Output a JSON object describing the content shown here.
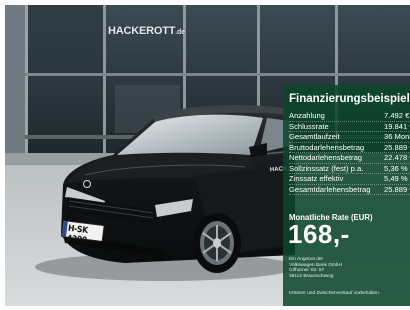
{
  "scene": {
    "dealer_sign": "HACKEROTT",
    "dealer_sign_suffix": ".de",
    "license_plate": "H-SK 4300",
    "door_lettering": "HACK"
  },
  "panel": {
    "title": "Finanzierungsbeispiel",
    "rows": [
      {
        "label": "Anzahlung",
        "value": "7.492 €"
      },
      {
        "label": "Schlussrate",
        "value": "19.841 €"
      },
      {
        "label": "Gesamtlaufzeit",
        "value": "36 Monate"
      },
      {
        "label": "Bruttodarlehensbetrag",
        "value": "25.889 €"
      },
      {
        "label": "Nettodarlehensbetrag",
        "value": "22.478 €"
      },
      {
        "label": "Sollzinssatz (fest) p.a.",
        "value": "5,36 %"
      },
      {
        "label": "Zinssatz effektiv",
        "value": "5,49 %"
      },
      {
        "label": "Gesamtdarlehensbetrag",
        "value": "25.889 €"
      }
    ],
    "rate_label": "Monatliche Rate (EUR)",
    "rate_value": "168,-",
    "offer_lines": [
      "Ein Angebot der",
      "Volkswagen Bank GmbH",
      "Gifhorner Str. 57",
      "38112 Braunschweig"
    ],
    "footnote": "Irrtümer und Zwischenverkauf vorbehalten."
  },
  "colors": {
    "panel": "#0c462c",
    "car": "#111416",
    "building": "#1f2a30"
  }
}
